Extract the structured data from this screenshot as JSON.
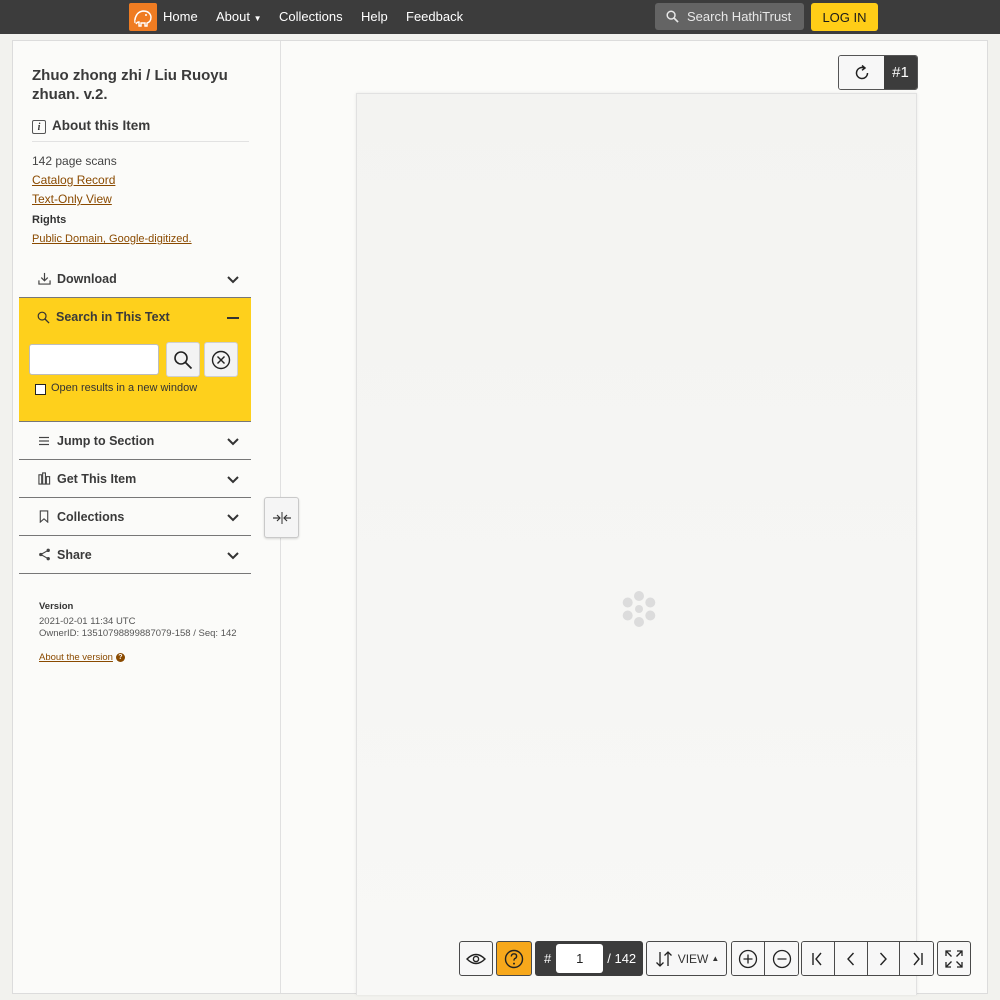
{
  "nav": {
    "home": "Home",
    "about": "About",
    "collections": "Collections",
    "help": "Help",
    "feedback": "Feedback",
    "search_label": "Search HathiTrust",
    "login": "LOG IN"
  },
  "sidebar": {
    "title": "Zhuo zhong zhi / Liu Ruoyu zhuan. v.2.",
    "about_heading": "About this Item",
    "page_scans": "142 page scans",
    "catalog_record": "Catalog Record",
    "text_only_view": "Text-Only View",
    "rights_label": "Rights",
    "rights_value": "Public Domain, Google-digitized.",
    "download": "Download",
    "search_heading": "Search in This Text",
    "search_placeholder": "",
    "open_new_window": "Open results in a new window",
    "jump_to_section": "Jump to Section",
    "get_this_item": "Get This Item",
    "collections": "Collections",
    "share": "Share",
    "version_label": "Version",
    "version_date": "2021-02-01 11:34 UTC",
    "version_owner": "OwnerID: 13510798899887079-158 / Seq: 142",
    "about_version": "About the version"
  },
  "viewer": {
    "seq_badge": "#1",
    "page_hash": "#",
    "current_page": "1",
    "total_pages": "/ 142",
    "view_label": "VIEW"
  },
  "colors": {
    "navbar": "#3c3c3c",
    "accent_yellow": "#fed01c",
    "link_brown": "#8a4a00",
    "help_orange": "#f7a81b"
  }
}
